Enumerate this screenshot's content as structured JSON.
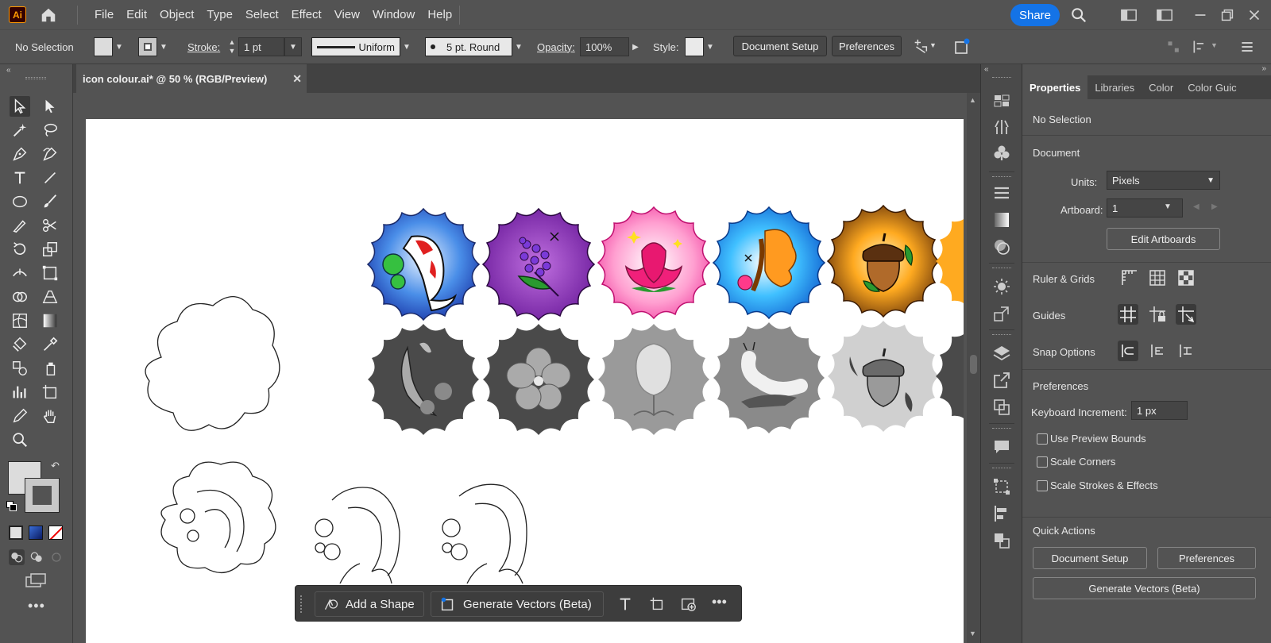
{
  "app": {
    "logo": "Ai"
  },
  "menu": [
    "File",
    "Edit",
    "Object",
    "Type",
    "Select",
    "Effect",
    "View",
    "Window",
    "Help"
  ],
  "share_label": "Share",
  "control_bar": {
    "selection": "No Selection",
    "stroke_label": "Stroke:",
    "stroke_value": "1 pt",
    "profile": "Uniform",
    "brush": "5 pt. Round",
    "opacity_label": "Opacity:",
    "opacity_value": "100%",
    "style_label": "Style:",
    "document_setup": "Document Setup",
    "preferences": "Preferences"
  },
  "document": {
    "tab_title": "icon colour.ai* @ 50 % (RGB/Preview)",
    "close": "✕"
  },
  "taskbar": {
    "add_shape": "Add a Shape",
    "generate": "Generate Vectors (Beta)"
  },
  "panel": {
    "tabs": [
      "Properties",
      "Libraries",
      "Color",
      "Color Guic"
    ],
    "selection": "No Selection",
    "document_header": "Document",
    "units_label": "Units:",
    "units_value": "Pixels",
    "artboard_label": "Artboard:",
    "artboard_value": "1",
    "edit_artboards": "Edit Artboards",
    "ruler_grids": "Ruler & Grids",
    "guides": "Guides",
    "snap_options": "Snap Options",
    "preferences_header": "Preferences",
    "keyboard_increment_label": "Keyboard Increment:",
    "keyboard_increment_value": "1 px",
    "use_preview_bounds": "Use Preview Bounds",
    "scale_corners": "Scale Corners",
    "scale_strokes": "Scale Strokes & Effects",
    "quick_actions": "Quick Actions",
    "qa_document_setup": "Document Setup",
    "qa_preferences": "Preferences",
    "qa_generate": "Generate Vectors (Beta)"
  },
  "colors": {
    "accent": "#1473e6",
    "ui_bg": "#535353",
    "artboard": "#ffffff"
  }
}
